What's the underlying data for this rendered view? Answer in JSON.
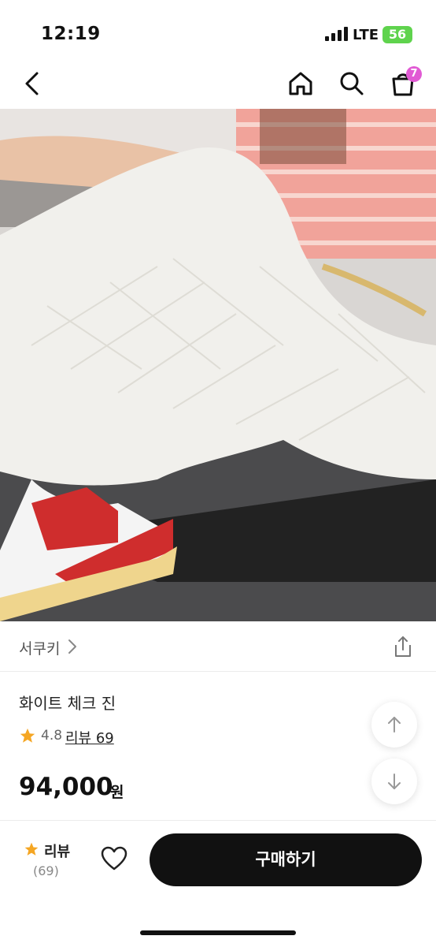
{
  "status_bar": {
    "time": "12:19",
    "network": "LTE",
    "battery": "56"
  },
  "nav": {
    "back_icon": "chevron-left-icon",
    "home_icon": "home-icon",
    "search_icon": "search-icon",
    "cart_icon": "shopping-bag-icon",
    "cart_count": "7",
    "badge_color": "#e15ad4"
  },
  "product": {
    "image_icon": "product-photo",
    "shop_name": "서쿠키",
    "title": "화이트 체크 진",
    "rating": "4.8",
    "review_link": "리뷰 69",
    "price": "94,000",
    "price_unit": "원"
  },
  "bottom_bar": {
    "review_label": "리뷰",
    "review_count": "(69)",
    "buy_label": "구매하기",
    "like_icon": "heart-icon",
    "star_color": "#f5a623"
  }
}
